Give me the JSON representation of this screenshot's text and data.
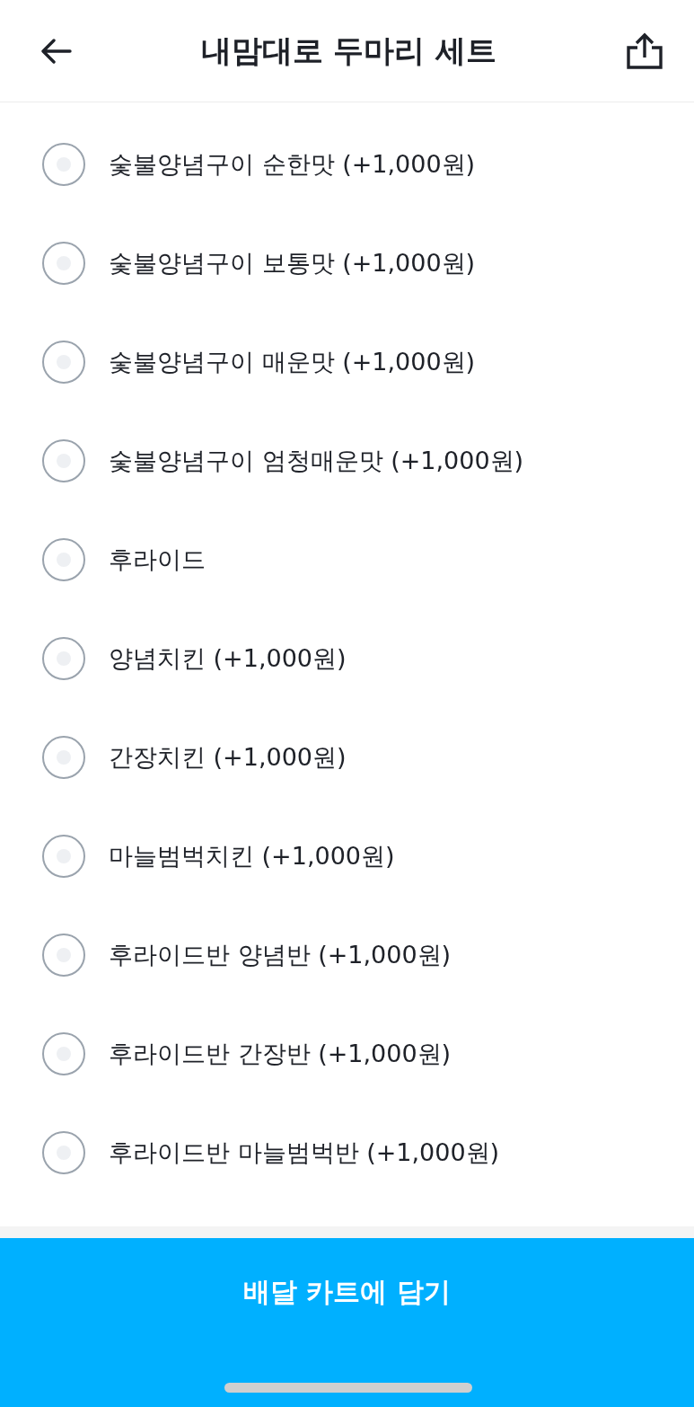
{
  "header": {
    "title": "내맘대로 두마리 세트"
  },
  "options": [
    {
      "label": "숯불양념구이 순한맛 (+1,000원)",
      "selected": false
    },
    {
      "label": "숯불양념구이 보통맛 (+1,000원)",
      "selected": false
    },
    {
      "label": "숯불양념구이 매운맛 (+1,000원)",
      "selected": false
    },
    {
      "label": "숯불양념구이 엄청매운맛 (+1,000원)",
      "selected": false
    },
    {
      "label": "후라이드",
      "selected": false
    },
    {
      "label": "양념치킨 (+1,000원)",
      "selected": false
    },
    {
      "label": "간장치킨 (+1,000원)",
      "selected": false
    },
    {
      "label": "마늘범벅치킨 (+1,000원)",
      "selected": false
    },
    {
      "label": "후라이드반 양념반 (+1,000원)",
      "selected": false
    },
    {
      "label": "후라이드반 간장반 (+1,000원)",
      "selected": false
    },
    {
      "label": "후라이드반 마늘범벅반 (+1,000원)",
      "selected": false
    }
  ],
  "cart_button": {
    "label": "배달 카트에 담기"
  }
}
